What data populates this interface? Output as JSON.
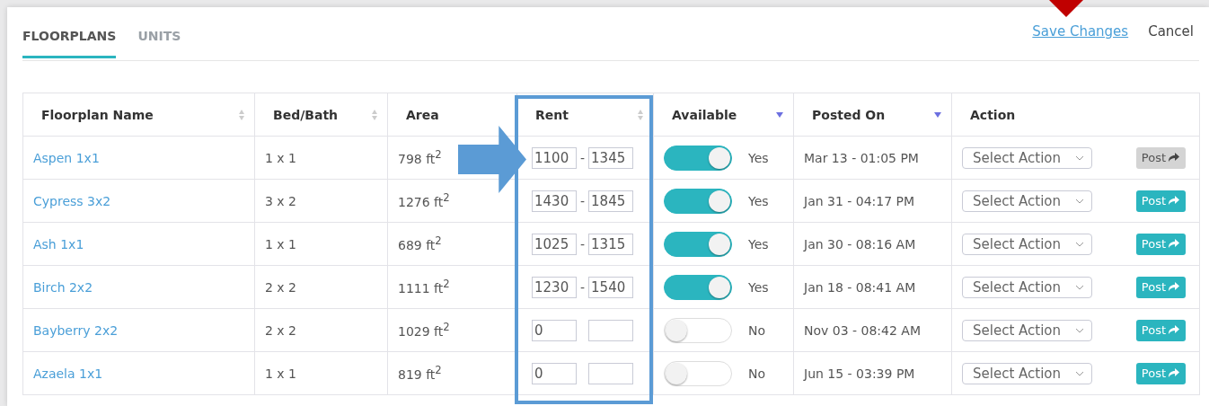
{
  "tabs": [
    {
      "label": "FLOORPLANS",
      "selected": true
    },
    {
      "label": "UNITS",
      "selected": false
    }
  ],
  "header_actions": {
    "save": "Save Changes",
    "cancel": "Cancel"
  },
  "table": {
    "columns": [
      {
        "label": "Floorplan Name",
        "sortable": true,
        "sorted": false
      },
      {
        "label": "Bed/Bath",
        "sortable": true,
        "sorted": false
      },
      {
        "label": "Area",
        "sortable": false
      },
      {
        "label": "Rent",
        "sortable": true,
        "sorted": false
      },
      {
        "label": "Available",
        "sortable": true,
        "sorted": true
      },
      {
        "label": "Posted On",
        "sortable": true,
        "sorted": true
      },
      {
        "label": "Action",
        "sortable": false
      }
    ],
    "rows": [
      {
        "name": "Aspen 1x1",
        "bed_bath": "1 x 1",
        "area": "798 ft$^{2}$",
        "rent_min": "1100",
        "separator": "-",
        "rent_max": "1345",
        "available": true,
        "available_label": "Yes",
        "posted_on": "Mar 13 - 01:05 PM",
        "action": "Select Action",
        "post": {
          "label": "Post",
          "disabled": true
        }
      },
      {
        "name": "Cypress 3x2",
        "bed_bath": "3 x 2",
        "area": "1276 ft$^{2}$",
        "rent_min": "1430",
        "separator": "-",
        "rent_max": "1845",
        "available": true,
        "available_label": "Yes",
        "posted_on": "Jan 31 - 04:17 PM",
        "action": "Select Action",
        "post": {
          "label": "Post",
          "disabled": false
        }
      },
      {
        "name": "Ash 1x1",
        "bed_bath": "1 x 1",
        "area": "689 ft$^{2}$",
        "rent_min": "1025",
        "separator": "-",
        "rent_max": "1315",
        "available": true,
        "available_label": "Yes",
        "posted_on": "Jan 30 - 08:16 AM",
        "action": "Select Action",
        "post": {
          "label": "Post",
          "disabled": false
        }
      },
      {
        "name": "Birch 2x2",
        "bed_bath": "2 x 2",
        "area": "1111 ft$^{2}$",
        "rent_min": "1230",
        "separator": "-",
        "rent_max": "1540",
        "available": true,
        "available_label": "Yes",
        "posted_on": "Jan 18 - 08:41 AM",
        "action": "Select Action",
        "post": {
          "label": "Post",
          "disabled": false
        }
      },
      {
        "name": "Bayberry 2x2",
        "bed_bath": "2 x 2",
        "area": "1029 ft$^{2}$",
        "rent_min": "0",
        "available": false,
        "available_label": "No",
        "posted_on": "Nov 03 - 08:42 AM",
        "action": "Select Action",
        "post": {
          "label": "Post",
          "disabled": false
        }
      },
      {
        "name": "Azaela 1x1",
        "bed_bath": "1 x 1",
        "area": "819 ft$^{2}$",
        "rent_min": "0",
        "available": false,
        "available_label": "No",
        "posted_on": "Jun 15 - 03:39 PM",
        "action": "Select Action",
        "post": {
          "label": "Post",
          "disabled": false
        }
      }
    ]
  }
}
